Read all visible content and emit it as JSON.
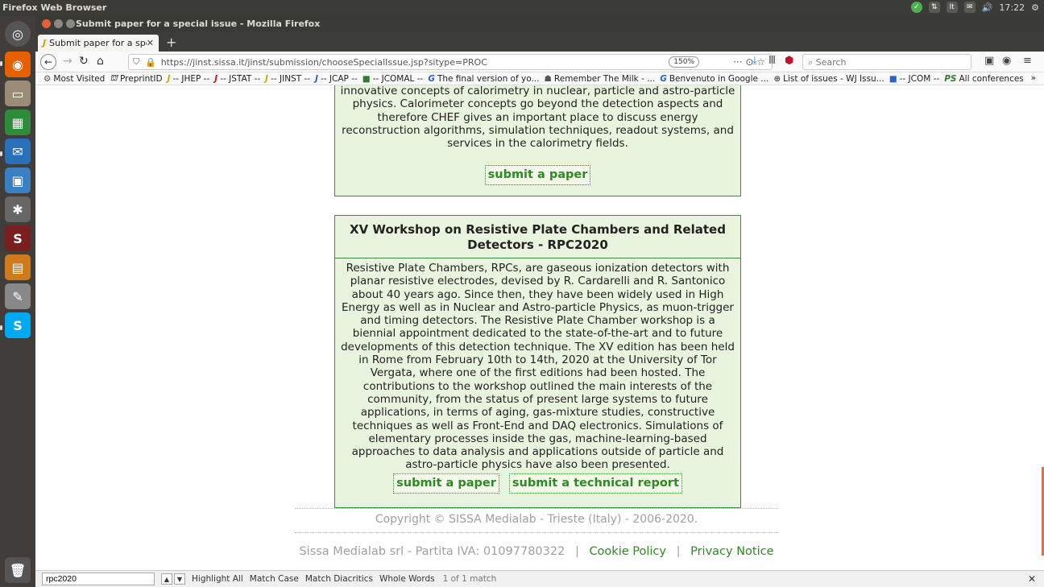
{
  "top_panel": {
    "app_name": "Firefox Web Browser",
    "clock": "17:22",
    "icons": [
      "check-icon",
      "network-icon",
      "keyboard-icon",
      "mail-icon",
      "volume-icon",
      "settings-icon"
    ]
  },
  "window": {
    "title": "Submit paper for a special issue - Mozilla Firefox"
  },
  "tabs": [
    {
      "label": "Submit paper for a speci",
      "favicon": "J"
    }
  ],
  "navbar": {
    "url": "https://jinst.sissa.it/jinst/submission/chooseSpecialIssue.jsp?sitype=PROC",
    "zoom": "150%",
    "extras": "··· ⊙ ☆",
    "search_placeholder": "Search"
  },
  "bookmarks": [
    {
      "label": "Most Visited",
      "icon": "⚙",
      "color": "plain"
    },
    {
      "label": "PreprintID",
      "icon": "⛫",
      "color": "plain"
    },
    {
      "label": "-- JHEP --",
      "icon": "J",
      "color": "yellow"
    },
    {
      "label": "-- JSTAT --",
      "icon": "J",
      "color": "red"
    },
    {
      "label": "-- JINST --",
      "icon": "J",
      "color": "yellow"
    },
    {
      "label": "-- JCAP --",
      "icon": "J",
      "color": "blue"
    },
    {
      "label": "-- JCOMAL --",
      "icon": "■",
      "color": "green"
    },
    {
      "label": "The final version of yo...",
      "icon": "G",
      "color": "blue"
    },
    {
      "label": "Remember The Milk - ...",
      "icon": "☗",
      "color": "plain"
    },
    {
      "label": "Benvenuto in Google ...",
      "icon": "G",
      "color": "blue"
    },
    {
      "label": "List of issues - WJ Issu...",
      "icon": "⊕",
      "color": "plain"
    },
    {
      "label": "-- JCOM --",
      "icon": "■",
      "color": "blue"
    },
    {
      "label": "All conferences",
      "icon": "PS",
      "color": "green"
    }
  ],
  "card1": {
    "text": "innovative concepts of calorimetry in nuclear, particle and astro-particle physics. Calorimeter concepts go beyond the detection aspects and therefore CHEF gives an important place to discuss energy reconstruction algorithms, simulation techniques, readout systems, and services in the calorimetry fields.",
    "submit_paper": "submit a paper"
  },
  "card2": {
    "title": "XV Workshop on Resistive Plate Chambers and Related Detectors - RPC2020",
    "text": "Resistive Plate Chambers, RPCs, are gaseous ionization detectors with planar resistive electrodes, devised by R. Cardarelli and R. Santonico about 40 years ago. Since then, they have been widely used in High Energy as well as in Nuclear and Astro-particle Physics, as muon-trigger and timing detectors. The Resistive Plate Chamber workshop is a biennial appointment dedicated to the state-of-the-art and to future developments of this detection technique. The XV edition has been held in Rome from February 10th to 14th, 2020 at the University of Tor Vergata, where one of the first editions had been hosted. The contributions to the workshop outlined the main interests of the community, from the status of present large systems to future applications, in terms of aging, gas-mixture studies, constructive techniques as well as Front-End and DAQ electronics. Simulations of elementary processes inside the gas, machine-learning-based approaches to data analysis and applications outside of particle and astro-particle physics have also been presented.",
    "submit_paper": "submit a paper",
    "submit_report": "submit a technical report"
  },
  "footer": {
    "copyright": "Copyright © SISSA Medialab - Trieste (Italy) - 2006-2020.",
    "company": "Sissa Medialab srl - Partita IVA: 01097780322",
    "separator": "|",
    "cookie_policy": "Cookie Policy",
    "privacy_notice": "Privacy Notice"
  },
  "findbar": {
    "query": "rpc2020",
    "highlight_all": "Highlight All",
    "match_case": "Match Case",
    "match_diacritics": "Match Diacritics",
    "whole_words": "Whole Words",
    "status": "1 of 1 match"
  },
  "colors": {
    "accent_green": "#2e8a22",
    "card_bg": "#e9f4df",
    "card_border": "#3a8c3a"
  }
}
